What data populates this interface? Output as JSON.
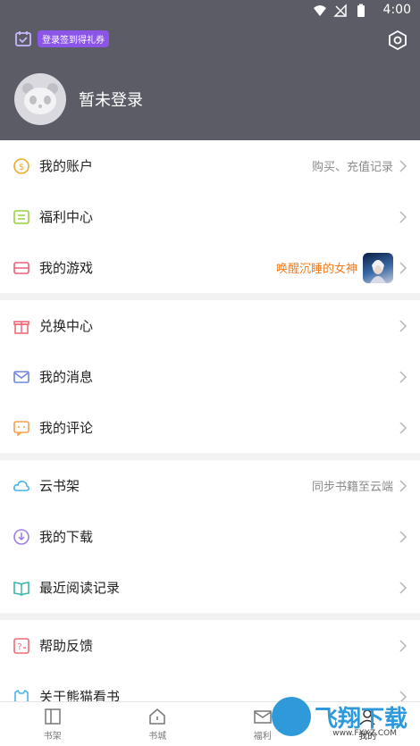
{
  "status_bar": {
    "time": "4:00"
  },
  "header": {
    "checkin_badge": "登录签到得礼券",
    "login_prompt": "暂未登录"
  },
  "section1": {
    "items": [
      {
        "label": "我的账户",
        "right": "购买、充值记录"
      },
      {
        "label": "福利中心",
        "right": ""
      },
      {
        "label": "我的游戏",
        "right": "唤醒沉睡的女神"
      }
    ]
  },
  "section2": {
    "items": [
      {
        "label": "兑换中心"
      },
      {
        "label": "我的消息"
      },
      {
        "label": "我的评论"
      }
    ]
  },
  "section3": {
    "items": [
      {
        "label": "云书架",
        "right": "同步书籍至云端"
      },
      {
        "label": "我的下载"
      },
      {
        "label": "最近阅读记录"
      }
    ]
  },
  "section4": {
    "items": [
      {
        "label": "帮助反馈"
      },
      {
        "label": "关于熊猫看书"
      }
    ]
  },
  "bottom_nav": {
    "items": [
      {
        "label": "书架"
      },
      {
        "label": "书城"
      },
      {
        "label": "福利"
      },
      {
        "label": "我的"
      }
    ]
  },
  "watermark": {
    "text": "飞翔下载",
    "sub": "www.FXXZ.COM"
  },
  "colors": {
    "header": "#5b5c66",
    "accent_orange": "#f47c1f",
    "badge": "#8b55e8"
  }
}
